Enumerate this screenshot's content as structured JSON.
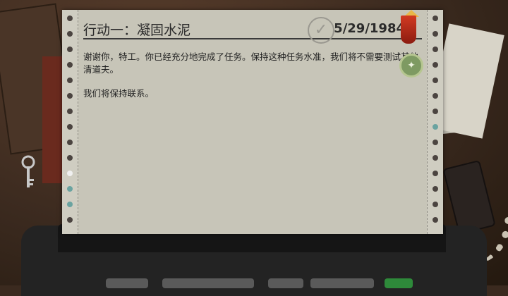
{
  "document": {
    "title": "行动一：凝固水泥",
    "date": "5/29/1984",
    "paragraphs": [
      "谢谢你，特工。你已经充分地完成了任务。保持这种任务水准，我们将不需要测试其他清道夫。",
      "我们将保持联系。"
    ]
  },
  "icons": {
    "stamp": "check-stamp-icon",
    "rank": "rank-chevron-icon",
    "medal": "medal-icon"
  },
  "colors": {
    "paper": "#c7c5b8",
    "rank_red": "#d23a22",
    "medal_green": "#7e9a62"
  }
}
